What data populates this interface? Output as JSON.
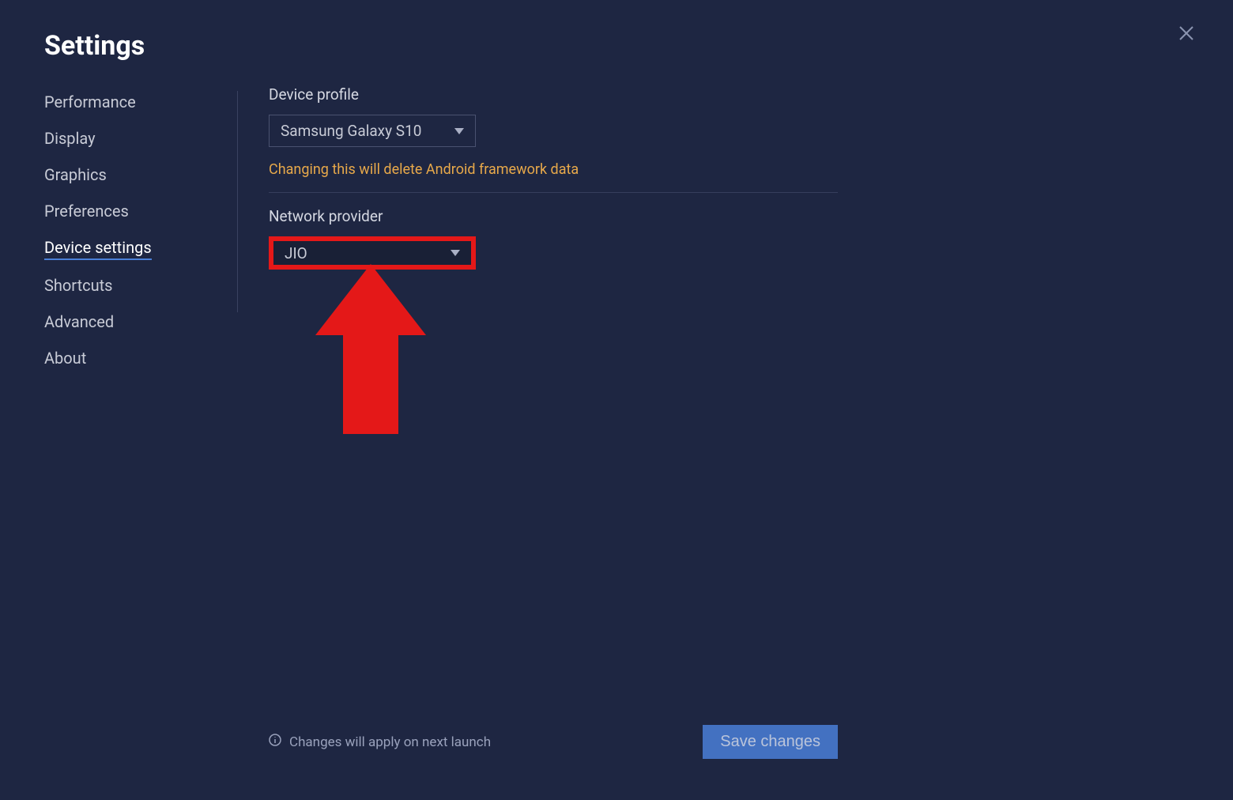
{
  "title": "Settings",
  "sidebar": {
    "items": [
      {
        "label": "Performance"
      },
      {
        "label": "Display"
      },
      {
        "label": "Graphics"
      },
      {
        "label": "Preferences"
      },
      {
        "label": "Device settings"
      },
      {
        "label": "Shortcuts"
      },
      {
        "label": "Advanced"
      },
      {
        "label": "About"
      }
    ],
    "activeIndex": 4
  },
  "content": {
    "deviceProfile": {
      "label": "Device profile",
      "value": "Samsung Galaxy S10",
      "warning": "Changing this will delete Android framework data"
    },
    "networkProvider": {
      "label": "Network provider",
      "value": "JIO"
    }
  },
  "footer": {
    "info": "Changes will apply on next launch",
    "saveLabel": "Save changes"
  }
}
